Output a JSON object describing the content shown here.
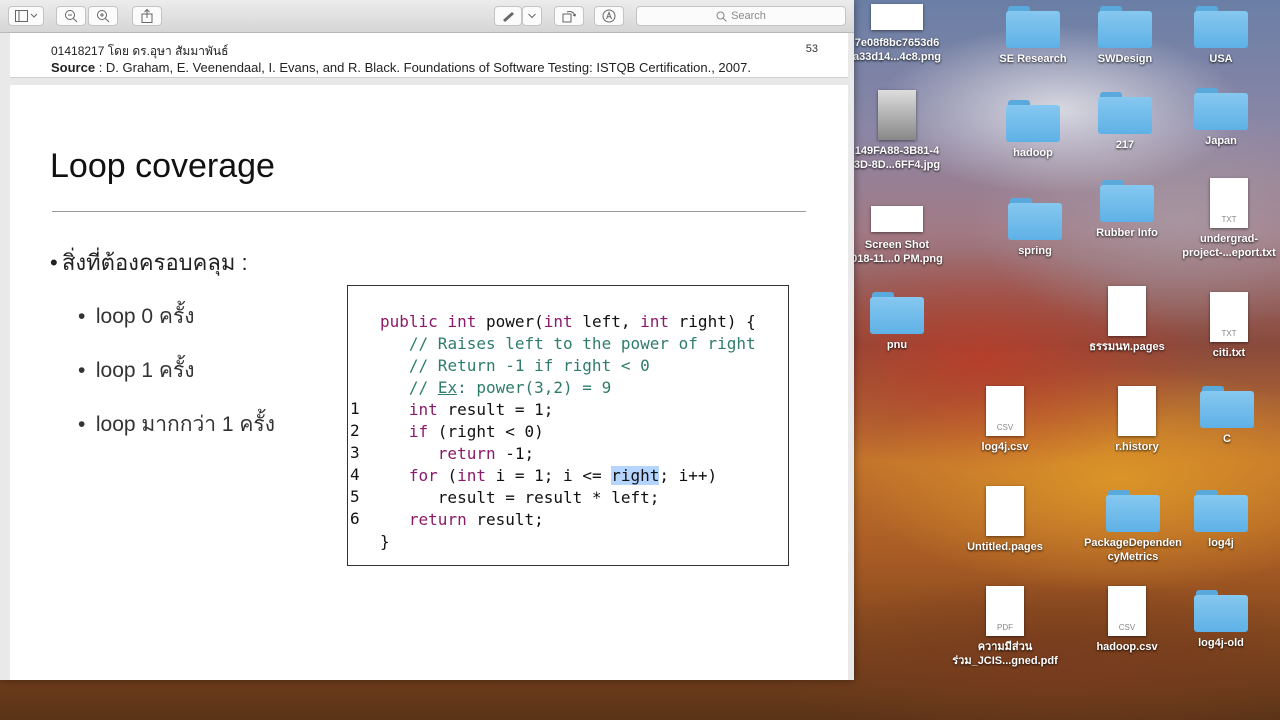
{
  "toolbar": {
    "search_placeholder": "Search",
    "buttons": [
      "sidebar-toggle",
      "zoom-out",
      "zoom-in",
      "share",
      "markup-pen",
      "markup-dropdown",
      "rotate",
      "annotate"
    ]
  },
  "prev_page": {
    "course_line": "01418217 โดย ดร.อุษา สัมมาพันธ์",
    "source_label": "Source",
    "source_text": " : D. Graham, E. Veenendaal, I. Evans, and R. Black. Foundations of Software Testing: ISTQB Certification., 2007.",
    "page_number": "53"
  },
  "slide": {
    "title": "Loop coverage",
    "bullet_main": "สิ่งที่ต้องครอบคลุม :",
    "sub_bullets": [
      "loop 0 ครั้ง",
      "loop 1 ครั้ง",
      "loop มากกว่า 1 ครั้ง"
    ]
  },
  "code": {
    "line_numbers": [
      "1",
      "2",
      "3",
      "4",
      "5",
      "6"
    ]
  },
  "desktop_icons": [
    {
      "label": "7e08f8bc7653d6\na33d14...4c8.png",
      "kind": "thumb"
    },
    {
      "label": "SE Research",
      "kind": "folder"
    },
    {
      "label": "SWDesign",
      "kind": "folder"
    },
    {
      "label": "USA",
      "kind": "folder"
    },
    {
      "label": "149FA88-3B81-4\n3D-8D...6FF4.jpg",
      "kind": "photo"
    },
    {
      "label": "hadoop",
      "kind": "folder"
    },
    {
      "label": "217",
      "kind": "folder"
    },
    {
      "label": "Japan",
      "kind": "folder"
    },
    {
      "label": "Screen Shot\n018-11...0 PM.png",
      "kind": "thumb"
    },
    {
      "label": "spring",
      "kind": "folder"
    },
    {
      "label": "Rubber Info",
      "kind": "folder"
    },
    {
      "label": "undergrad-\nproject-...eport.txt",
      "kind": "txt"
    },
    {
      "label": "pnu",
      "kind": "folder"
    },
    {
      "label": "ธรรมนท.pages",
      "kind": "doc"
    },
    {
      "label": "citi.txt",
      "kind": "txt"
    },
    {
      "label": "log4j.csv",
      "kind": "csv"
    },
    {
      "label": "r.history",
      "kind": "doc"
    },
    {
      "label": "C",
      "kind": "folder"
    },
    {
      "label": "Untitled.pages",
      "kind": "doc"
    },
    {
      "label": "PackageDependen\ncyMetrics",
      "kind": "folder"
    },
    {
      "label": "log4j",
      "kind": "folder"
    },
    {
      "label": "ความมีส่วน\nร่วม_JCIS...gned.pdf",
      "kind": "pdf"
    },
    {
      "label": "hadoop.csv",
      "kind": "csv"
    },
    {
      "label": "log4j-old",
      "kind": "folder"
    }
  ]
}
